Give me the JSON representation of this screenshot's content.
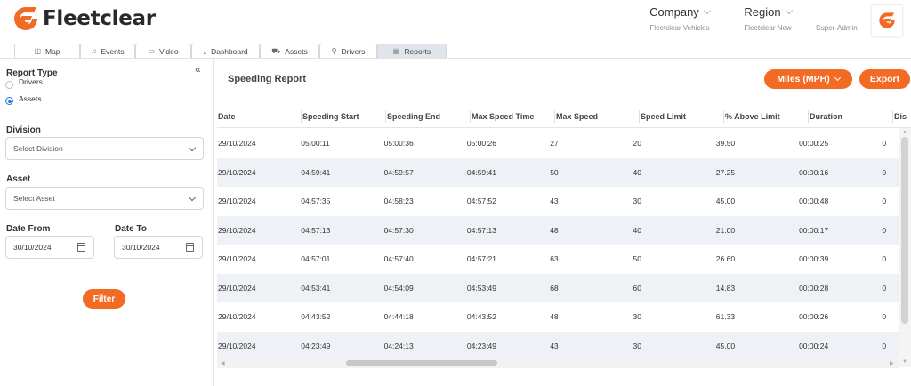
{
  "brand": {
    "name": "Fleetclear",
    "accent": "#f26a24"
  },
  "header": {
    "company": {
      "label": "Company",
      "value": "Fleetclear Vehicles"
    },
    "region": {
      "label": "Region",
      "value": "Fleetclear New"
    },
    "role": "Super-Admin"
  },
  "tabs": [
    {
      "label": "Map",
      "icon": "camera-icon"
    },
    {
      "label": "Events",
      "icon": "bell-icon"
    },
    {
      "label": "Video",
      "icon": "video-icon"
    },
    {
      "label": "Dashboard",
      "icon": "chart-icon"
    },
    {
      "label": "Assets",
      "icon": "truck-icon"
    },
    {
      "label": "Drivers",
      "icon": "user-icon"
    },
    {
      "label": "Reports",
      "icon": "document-icon",
      "active": true
    }
  ],
  "sidebar": {
    "report_type_label": "Report Type",
    "report_types": [
      {
        "label": "Drivers",
        "selected": false
      },
      {
        "label": "Assets",
        "selected": true
      }
    ],
    "division_label": "Division",
    "division_placeholder": "Select Division",
    "asset_label": "Asset",
    "asset_placeholder": "Select Asset",
    "date_from_label": "Date From",
    "date_from_value": "30/10/2024",
    "date_to_label": "Date To",
    "date_to_value": "30/10/2024",
    "filter_label": "Filter"
  },
  "report": {
    "title": "Speeding Report",
    "units_label": "Miles (MPH)",
    "export_label": "Export",
    "columns": [
      "Date",
      "Speeding Start",
      "Speeding End",
      "Max Speed Time",
      "Max Speed",
      "Speed Limit",
      "% Above Limit",
      "Duration",
      "Dis"
    ],
    "rows": [
      [
        "29/10/2024",
        "05:00:11",
        "05:00:36",
        "05:00:26",
        "27",
        "20",
        "39.50",
        "00:00:25",
        "0"
      ],
      [
        "29/10/2024",
        "04:59:41",
        "04:59:57",
        "04:59:41",
        "50",
        "40",
        "27.25",
        "00:00:16",
        "0"
      ],
      [
        "29/10/2024",
        "04:57:35",
        "04:58:23",
        "04:57:52",
        "43",
        "30",
        "45.00",
        "00:00:48",
        "0"
      ],
      [
        "29/10/2024",
        "04:57:13",
        "04:57:30",
        "04:57:13",
        "48",
        "40",
        "21.00",
        "00:00:17",
        "0"
      ],
      [
        "29/10/2024",
        "04:57:01",
        "04:57:40",
        "04:57:21",
        "63",
        "50",
        "26.60",
        "00:00:39",
        "0"
      ],
      [
        "29/10/2024",
        "04:53:41",
        "04:54:09",
        "04:53:49",
        "68",
        "60",
        "14.83",
        "00:00:28",
        "0"
      ],
      [
        "29/10/2024",
        "04:43:52",
        "04:44:18",
        "04:43:52",
        "48",
        "30",
        "61.33",
        "00:00:26",
        "0"
      ],
      [
        "29/10/2024",
        "04:23:49",
        "04:24:13",
        "04:23:49",
        "43",
        "30",
        "45.00",
        "00:00:24",
        "0"
      ]
    ]
  }
}
